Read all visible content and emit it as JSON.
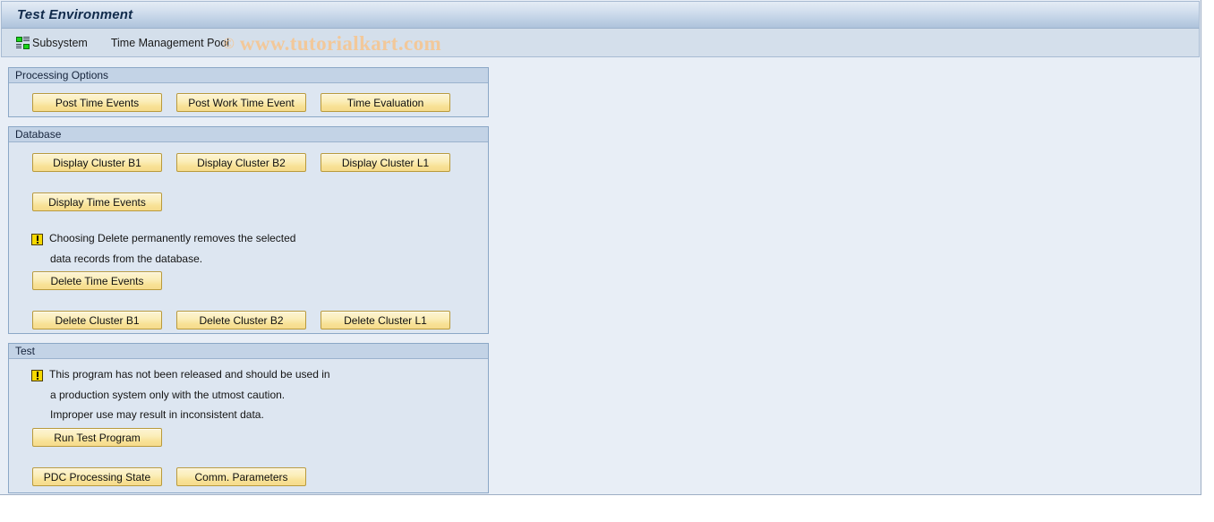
{
  "window": {
    "title": "Test Environment"
  },
  "toolbar": {
    "subsystem_icon": "subsystem-icon",
    "subsystem_label": "Subsystem",
    "pool_label": "Time Management Pool"
  },
  "watermark": {
    "copyright": "©",
    "text": "www.tutorialkart.com"
  },
  "groups": [
    {
      "id": "processing-options",
      "title": "Processing Options",
      "buttons": [
        {
          "id": "post-time-events",
          "label": "Post Time Events"
        },
        {
          "id": "post-work-time-event",
          "label": "Post Work Time Event"
        },
        {
          "id": "time-evaluation",
          "label": "Time Evaluation"
        }
      ]
    },
    {
      "id": "database",
      "title": "Database",
      "buttons": [
        {
          "id": "display-cluster-b1",
          "label": "Display Cluster B1"
        },
        {
          "id": "display-cluster-b2",
          "label": "Display Cluster B2"
        },
        {
          "id": "display-cluster-l1",
          "label": "Display Cluster L1"
        },
        {
          "id": "display-time-events",
          "label": "Display Time Events"
        },
        {
          "id": "delete-time-events",
          "label": "Delete Time Events"
        },
        {
          "id": "delete-cluster-b1",
          "label": "Delete Cluster B1"
        },
        {
          "id": "delete-cluster-b2",
          "label": "Delete Cluster B2"
        },
        {
          "id": "delete-cluster-l1",
          "label": "Delete Cluster L1"
        }
      ],
      "notice": {
        "icon": "warning-icon",
        "line1": "Choosing Delete permanently removes the selected",
        "line2": "data records from the database."
      }
    },
    {
      "id": "test",
      "title": "Test",
      "buttons": [
        {
          "id": "run-test-program",
          "label": "Run Test Program"
        },
        {
          "id": "pdc-processing-state",
          "label": "PDC Processing State"
        },
        {
          "id": "comm-parameters",
          "label": "Comm. Parameters"
        }
      ],
      "notice": {
        "icon": "warning-icon",
        "line1": "This program has not been released and should be used in",
        "line2": "a production system only with the utmost caution.",
        "line3": "Improper use may result in inconsistent data."
      }
    }
  ],
  "colors": {
    "button_face": "#fbeeb9",
    "button_border": "#b99a3c",
    "panel_bg": "#dde6f1",
    "group_header_bg": "#c3d3e6",
    "window_bg": "#e8eef6",
    "title_text": "#102a4b",
    "watermark": "#f2c89a",
    "warning_yellow": "#f5d800"
  }
}
